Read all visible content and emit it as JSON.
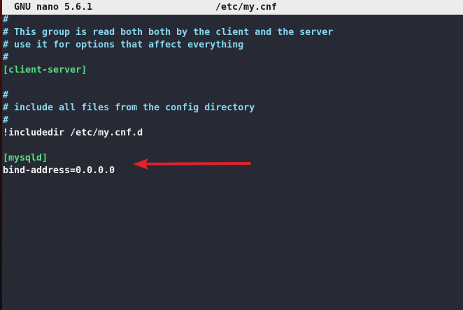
{
  "titlebar": {
    "app": "GNU nano 5.6.1",
    "filename": "/etc/my.cnf"
  },
  "lines": [
    {
      "text": "#",
      "type": "comment"
    },
    {
      "text": "# This group is read both both by the client and the server",
      "type": "comment"
    },
    {
      "text": "# use it for options that affect everything",
      "type": "comment"
    },
    {
      "text": "#",
      "type": "comment"
    },
    {
      "text": "[client-server]",
      "type": "section"
    },
    {
      "text": "",
      "type": "plain"
    },
    {
      "text": "#",
      "type": "comment"
    },
    {
      "text": "# include all files from the config directory",
      "type": "comment"
    },
    {
      "text": "#",
      "type": "comment"
    },
    {
      "text": "!includedir /etc/my.cnf.d",
      "type": "plain"
    },
    {
      "text": "",
      "type": "plain"
    },
    {
      "text": "[mysqld]",
      "type": "section"
    },
    {
      "text": "bind-address=0.0.0.0",
      "type": "plain"
    }
  ],
  "colors": {
    "comment": "#86d8ef",
    "section": "#55dd80",
    "plain": "#f2f2f2",
    "background": "#272a35",
    "arrow": "#e0222a"
  }
}
